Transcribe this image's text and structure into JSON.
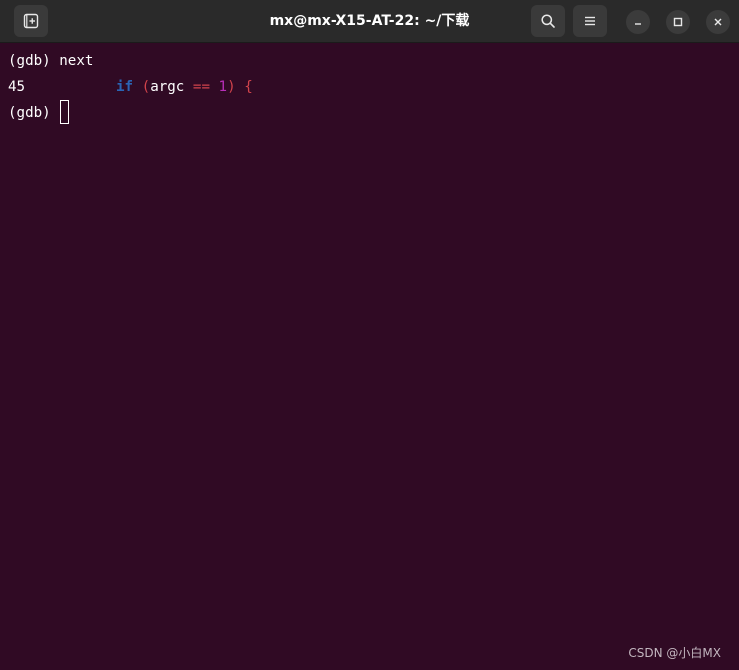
{
  "window": {
    "title": "mx@mx-X15-AT-22: ~/下载"
  },
  "titlebar": {
    "new_tab_icon": "new-tab-icon",
    "search_icon": "search-icon",
    "menu_icon": "hamburger-menu-icon",
    "minimize_icon": "minimize-icon",
    "maximize_icon": "maximize-icon",
    "close_icon": "close-icon"
  },
  "terminal": {
    "prompt": "(gdb)",
    "command": "next",
    "source_line": {
      "number": "45",
      "keyword": "if",
      "open_paren": "(",
      "variable": "argc",
      "operator": "==",
      "literal": "1",
      "close_paren": ")",
      "brace": "{"
    }
  },
  "watermark": "CSDN @小白MX",
  "colors": {
    "background": "#300a24",
    "titlebar": "#2a2a2a",
    "keyword": "#2a64b4",
    "paren": "#d1434b",
    "number": "#b92fb9"
  }
}
